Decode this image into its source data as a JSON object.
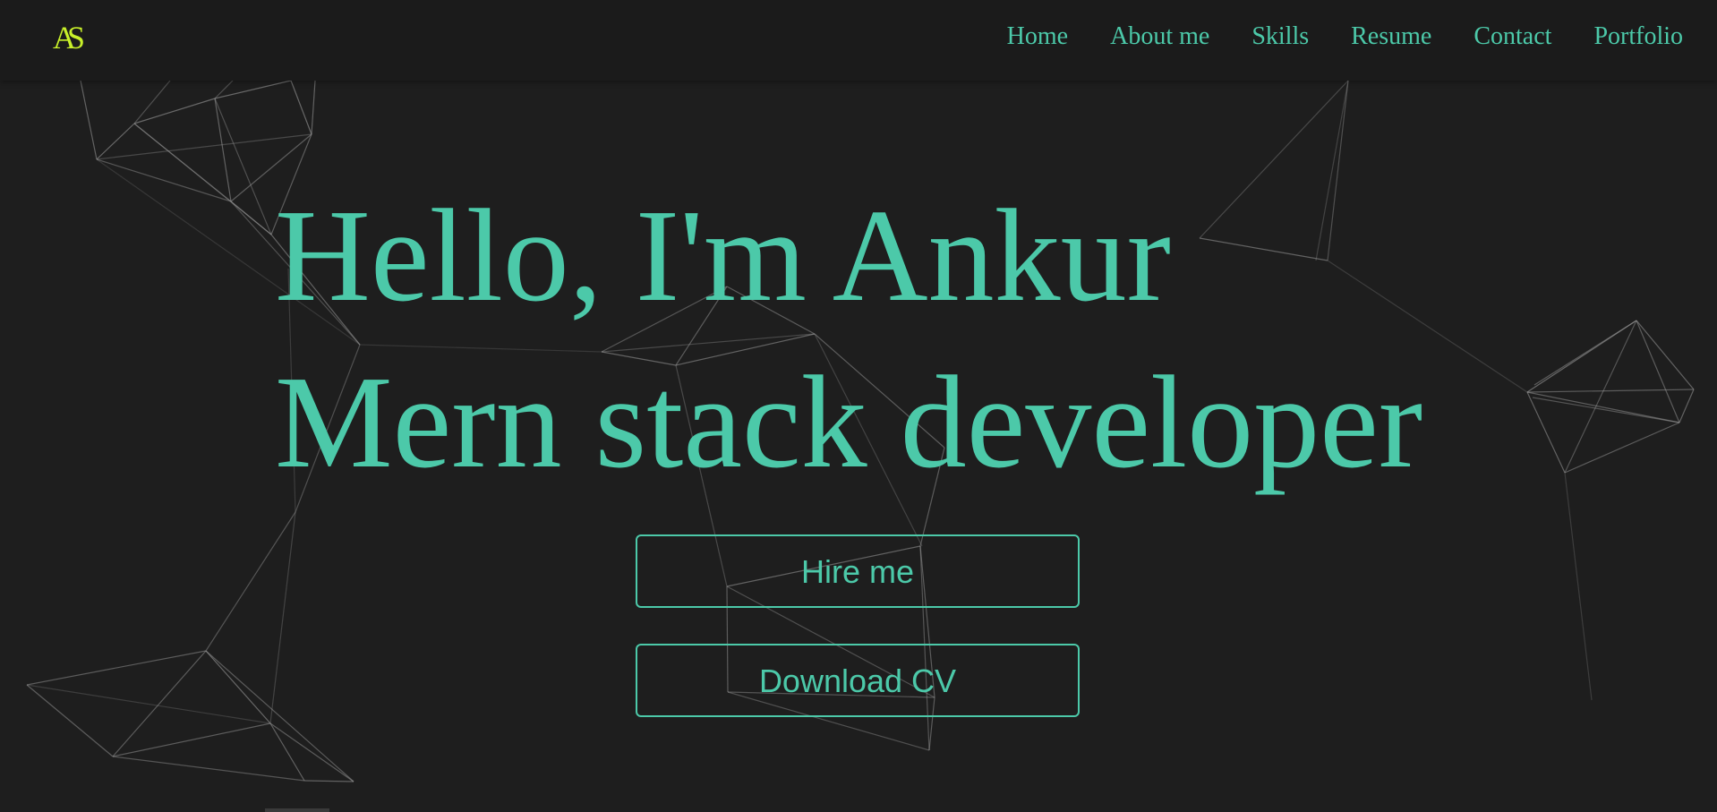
{
  "brand": {
    "logo_text": "AS",
    "logo_color": "#c8f02a"
  },
  "nav": {
    "items": [
      {
        "label": "Home"
      },
      {
        "label": "About me"
      },
      {
        "label": "Skills"
      },
      {
        "label": "Resume"
      },
      {
        "label": "Contact"
      },
      {
        "label": "Portfolio"
      }
    ]
  },
  "hero": {
    "greeting": "Hello, I'm Ankur",
    "role": "Mern stack developer",
    "hire_label": "Hire me",
    "cv_label": "Download CV"
  },
  "colors": {
    "accent": "#4cc9a9",
    "background": "#1e1e1e",
    "navbar": "#1b1b1b",
    "network_lines": "#9a9a9a"
  },
  "background_decoration": {
    "icon": "particle-network-icon"
  }
}
